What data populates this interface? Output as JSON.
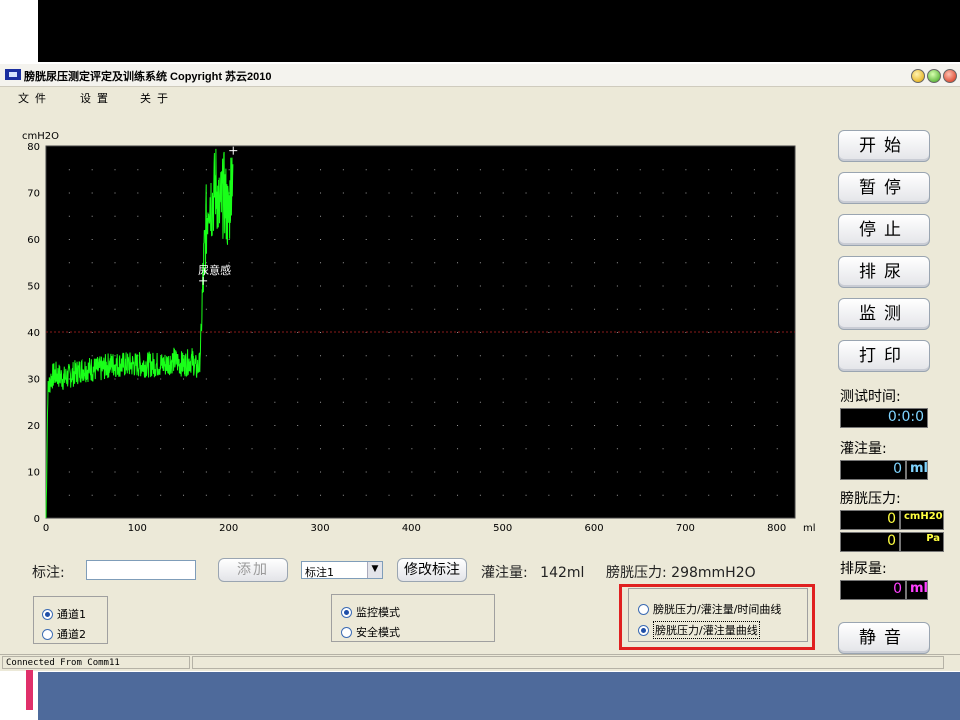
{
  "window": {
    "title": "膀胱尿压测定评定及训练系统  Copyright 苏云2010",
    "status": "Connected From Comm11"
  },
  "menu": [
    "文件",
    "设置",
    "关于"
  ],
  "side_buttons": [
    "开始",
    "暂停",
    "停止",
    "排尿",
    "监测",
    "打印"
  ],
  "mute_button": "静音",
  "readouts": {
    "test_time_label": "测试时间:",
    "test_time_value": "0:0:0",
    "infusion_label": "灌注量:",
    "infusion_value": "0",
    "infusion_unit": "ml",
    "pressure_label": "膀胱压力:",
    "pressure_cmh2o_value": "0",
    "pressure_cmh2o_unit": "cmH20",
    "pressure_pa_value": "0",
    "pressure_pa_unit": "Pa",
    "urine_label": "排尿量:",
    "urine_value": "0",
    "urine_unit": "ml"
  },
  "annotation_bar": {
    "label": "标注:",
    "input_value": "",
    "add_button": "添加",
    "select_value": "标注1",
    "modify_button": "修改标注",
    "infusion_text": "灌注量: 142ml",
    "pressure_text": "膀胱压力: 298mmH2O"
  },
  "channels": {
    "options": [
      "通道1",
      "通道2"
    ],
    "selected": 0
  },
  "modes": {
    "options": [
      "监控模式",
      "安全模式"
    ],
    "selected": 0
  },
  "curves": {
    "options": [
      "膀胱压力/灌注量/时间曲线",
      "膀胱压力/灌注量曲线"
    ],
    "selected": 1
  },
  "colors": {
    "trace": "#19ff19",
    "reference_line": "#8a1a1a",
    "grid_dot": "#9a9a9a",
    "readout_text": "#7fd4ff",
    "unit_yellow": "#ffff40",
    "urine_magenta": "#ff40ff",
    "highlight": "#e02020"
  },
  "chart_data": {
    "type": "line",
    "ylabel": "cmH2O",
    "xlabel": "ml",
    "xlim": [
      0,
      820
    ],
    "ylim": [
      0,
      80
    ],
    "x_ticks": [
      0,
      100,
      200,
      300,
      400,
      500,
      600,
      700,
      800
    ],
    "y_ticks": [
      0,
      10,
      20,
      30,
      40,
      50,
      60,
      70,
      80
    ],
    "reference_y": 40,
    "marker_label": "尿意感",
    "marker_points": [
      [
        172,
        51
      ],
      [
        205,
        79
      ]
    ],
    "series": [
      {
        "x": [
          0,
          2,
          5,
          10,
          20,
          30,
          40,
          50,
          60,
          70,
          80,
          90,
          100,
          110,
          120,
          130,
          140,
          150,
          160,
          165,
          168,
          170,
          172,
          175,
          178,
          182,
          186,
          190,
          195,
          200,
          203,
          205
        ],
        "y": [
          0,
          27,
          30,
          31,
          30,
          31,
          32,
          32,
          32,
          33,
          33,
          33,
          33,
          33,
          33,
          33,
          34,
          33,
          34,
          32,
          33,
          40,
          51,
          62,
          70,
          68,
          72,
          66,
          70,
          64,
          74,
          78
        ]
      }
    ]
  }
}
